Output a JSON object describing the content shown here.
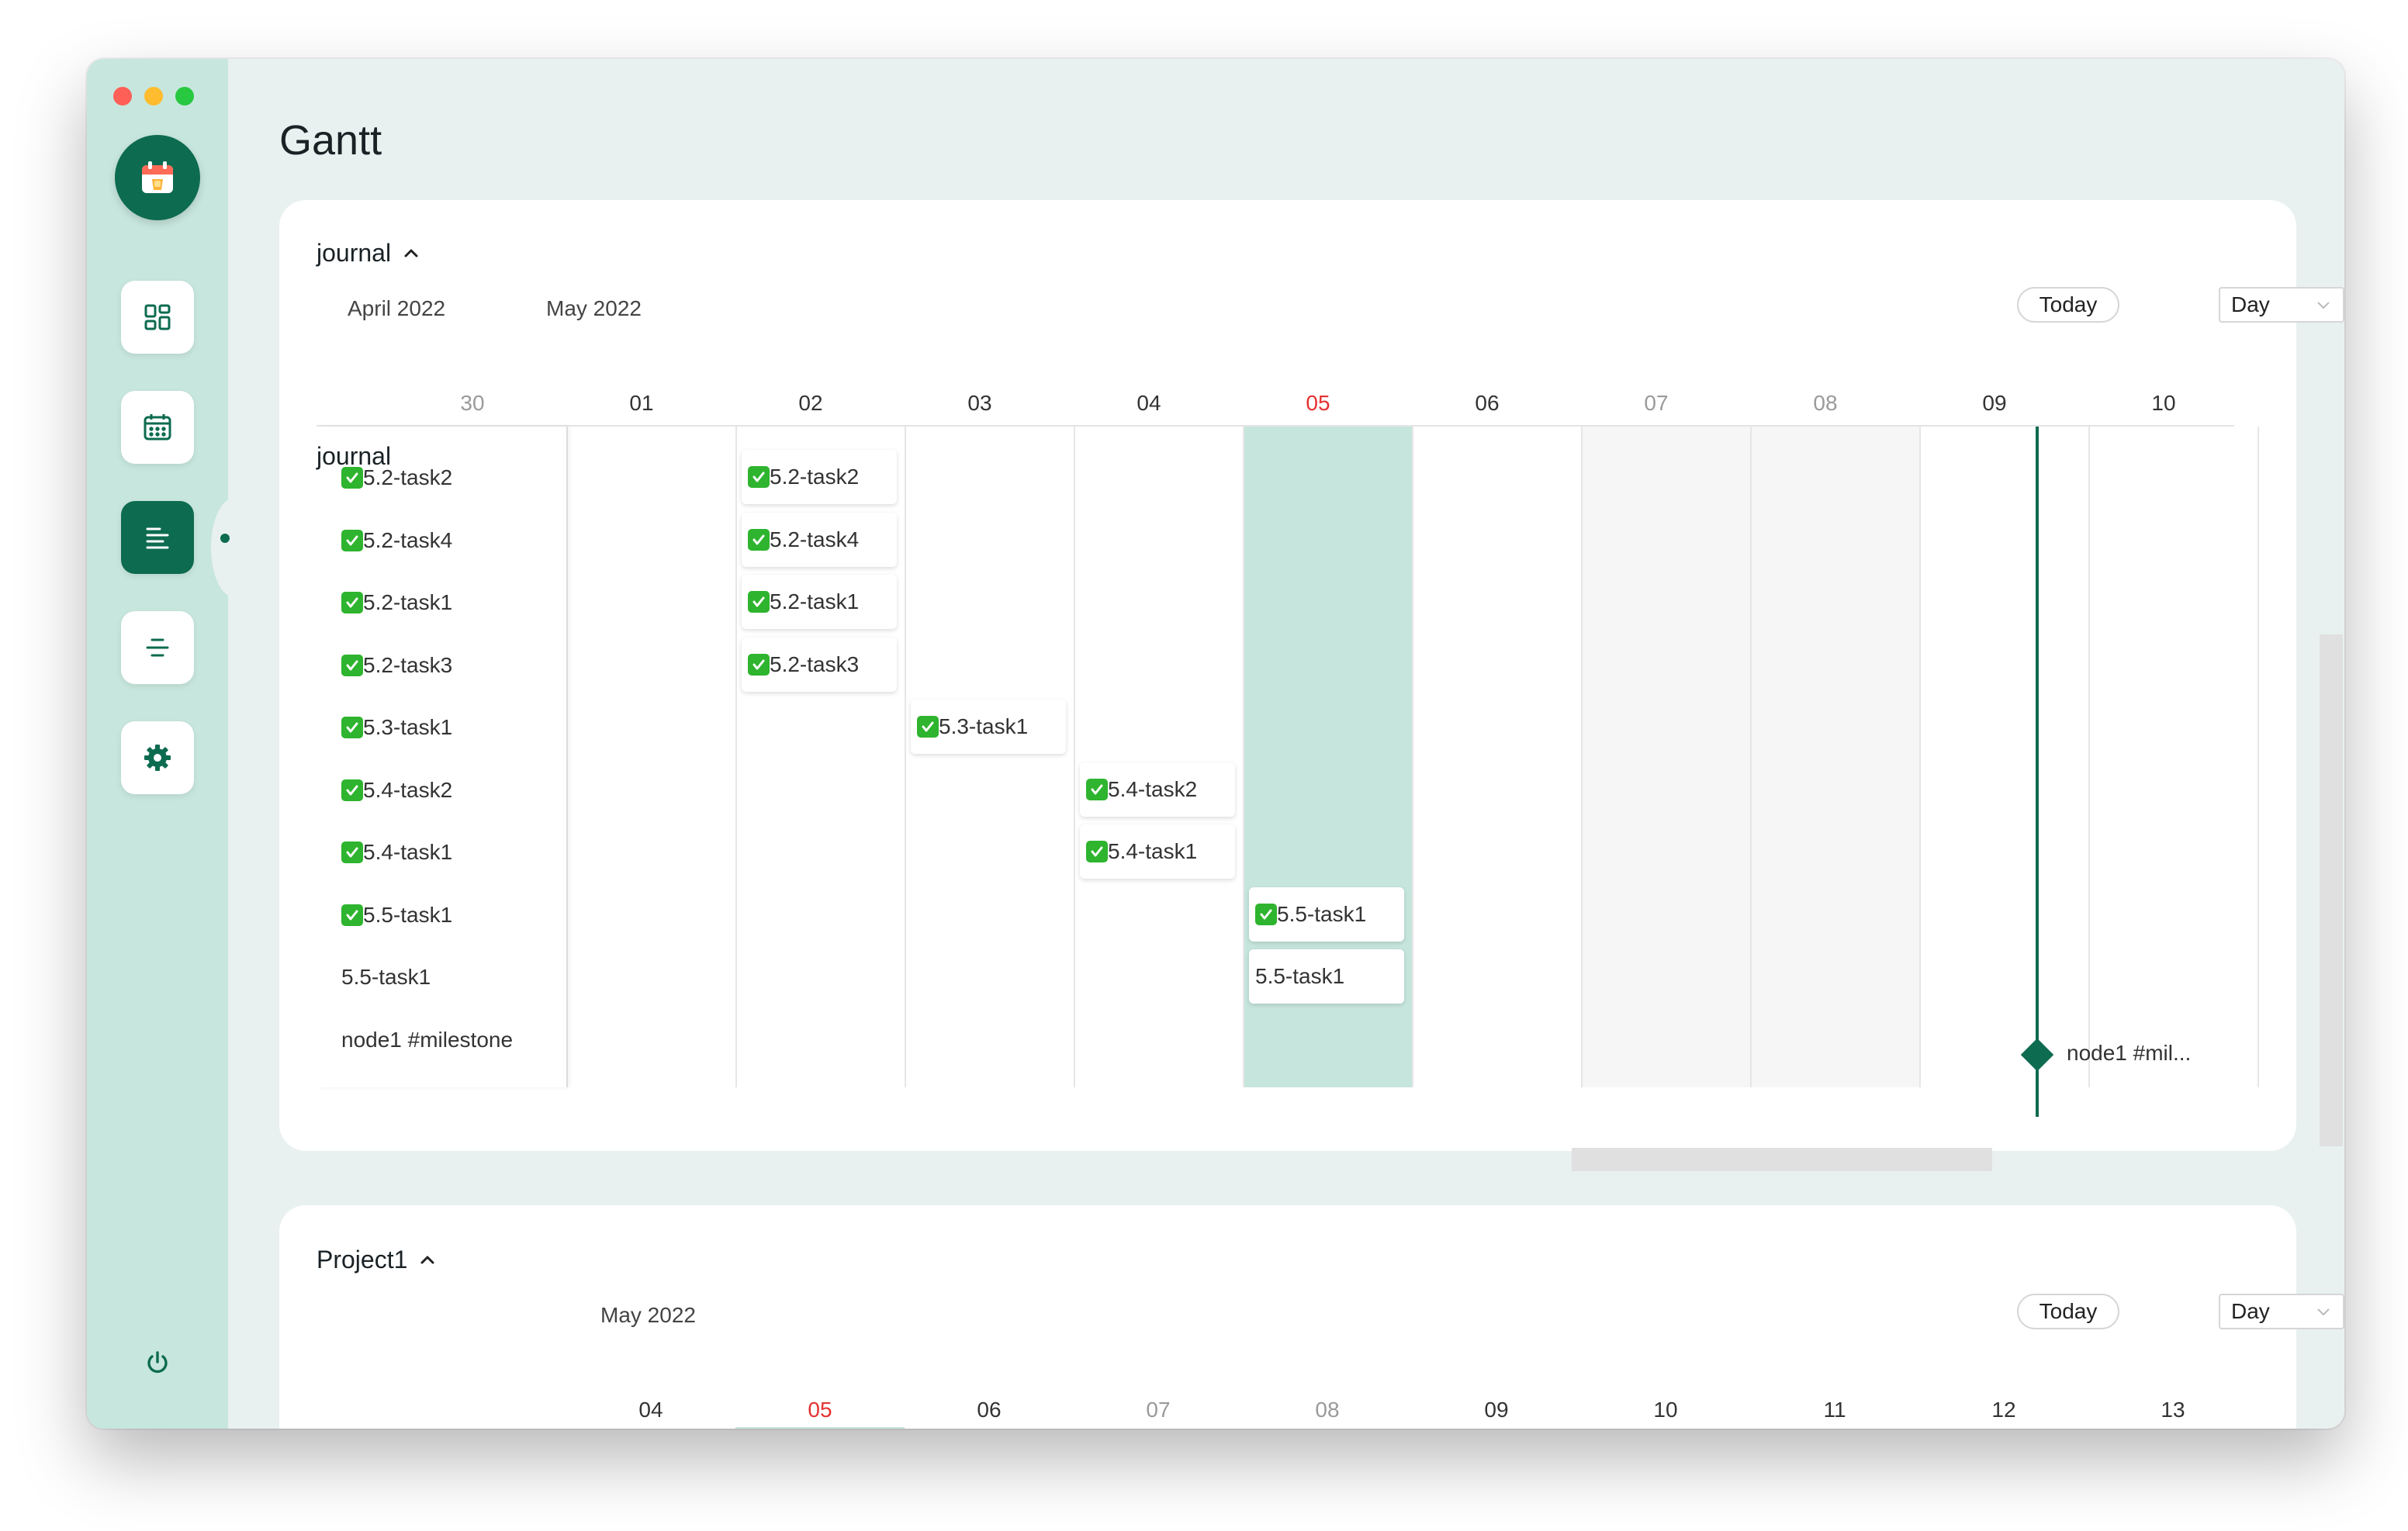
{
  "app": {
    "title": "Gantt",
    "colors": {
      "accent": "#0d6b4f",
      "sidebar": "#c7e6dd",
      "today_column": "#c6e6dd",
      "today_text": "#e53131"
    }
  },
  "sidebar": {
    "logo_icon": "calendar-app-icon",
    "items": [
      {
        "name": "dashboard",
        "icon": "grid-icon",
        "active": false
      },
      {
        "name": "calendar",
        "icon": "calendar-icon",
        "active": false
      },
      {
        "name": "gantt",
        "icon": "left-align-lines-icon",
        "active": true
      },
      {
        "name": "list",
        "icon": "center-align-lines-icon",
        "active": false
      },
      {
        "name": "settings",
        "icon": "gear-icon",
        "active": false
      }
    ],
    "footer_icon": "power-icon"
  },
  "gantt1": {
    "title": "journal",
    "months": [
      "April 2022",
      "May 2022"
    ],
    "today_button": "Today",
    "view_select": "Day",
    "days": [
      "30",
      "01",
      "02",
      "03",
      "04",
      "05",
      "06",
      "07",
      "08",
      "09",
      "10"
    ],
    "group_label": "journal",
    "rows": [
      {
        "label": "5.2-task2",
        "done": true
      },
      {
        "label": "5.2-task4",
        "done": true
      },
      {
        "label": "5.2-task1",
        "done": true
      },
      {
        "label": "5.2-task3",
        "done": true
      },
      {
        "label": "5.3-task1",
        "done": true
      },
      {
        "label": "5.4-task2",
        "done": true
      },
      {
        "label": "5.4-task1",
        "done": true
      },
      {
        "label": "5.5-task1",
        "done": true
      },
      {
        "label": "5.5-task1",
        "done": false
      },
      {
        "label": "node1 #milestone",
        "done": false
      }
    ],
    "bars": [
      {
        "label": "5.2-task2",
        "done": true,
        "day": "02"
      },
      {
        "label": "5.2-task4",
        "done": true,
        "day": "02"
      },
      {
        "label": "5.2-task1",
        "done": true,
        "day": "02"
      },
      {
        "label": "5.2-task3",
        "done": true,
        "day": "02"
      },
      {
        "label": "5.3-task1",
        "done": true,
        "day": "03"
      },
      {
        "label": "5.4-task2",
        "done": true,
        "day": "04"
      },
      {
        "label": "5.4-task1",
        "done": true,
        "day": "04"
      },
      {
        "label": "5.5-task1",
        "done": true,
        "day": "05"
      },
      {
        "label": "5.5-task1",
        "done": false,
        "day": "05"
      }
    ],
    "milestone": {
      "label": "node1 #mil...",
      "day": "09"
    }
  },
  "gantt2": {
    "title": "Project1",
    "months": [
      "May 2022"
    ],
    "today_button": "Today",
    "view_select": "Day",
    "days": [
      "04",
      "05",
      "06",
      "07",
      "08",
      "09",
      "10",
      "11",
      "12",
      "13"
    ]
  }
}
